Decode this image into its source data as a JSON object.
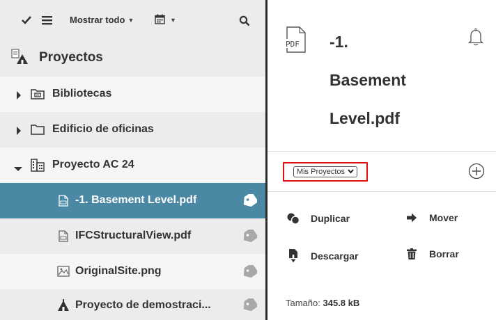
{
  "toolbar": {
    "show_all_label": "Mostrar todo",
    "icons": [
      "check-icon",
      "list-icon",
      "calendar-icon",
      "search-icon"
    ]
  },
  "sidebar": {
    "root_label": "Proyectos",
    "items": [
      {
        "label": "Bibliotecas"
      },
      {
        "label": "Edificio de oficinas"
      },
      {
        "label": "Proyecto AC 24"
      },
      {
        "label": "-1. Basement Level.pdf"
      },
      {
        "label": "IFCStructuralView.pdf"
      },
      {
        "label": "OriginalSite.png"
      },
      {
        "label": "Proyecto de demostraci..."
      }
    ]
  },
  "detail": {
    "file_type": "PDF",
    "title_lines": [
      "-1.",
      "Basement",
      "Level.pdf"
    ],
    "project_select": "Mis Proyectos",
    "actions": {
      "duplicate": "Duplicar",
      "move": "Mover",
      "download": "Descargar",
      "delete": "Borrar"
    },
    "size_label": "Tamaño:",
    "size_value": "345.8 kB"
  },
  "colors": {
    "selected_row": "#4a88a3",
    "highlight_border": "#e01010",
    "panel_divider": "#2b2b2b"
  }
}
